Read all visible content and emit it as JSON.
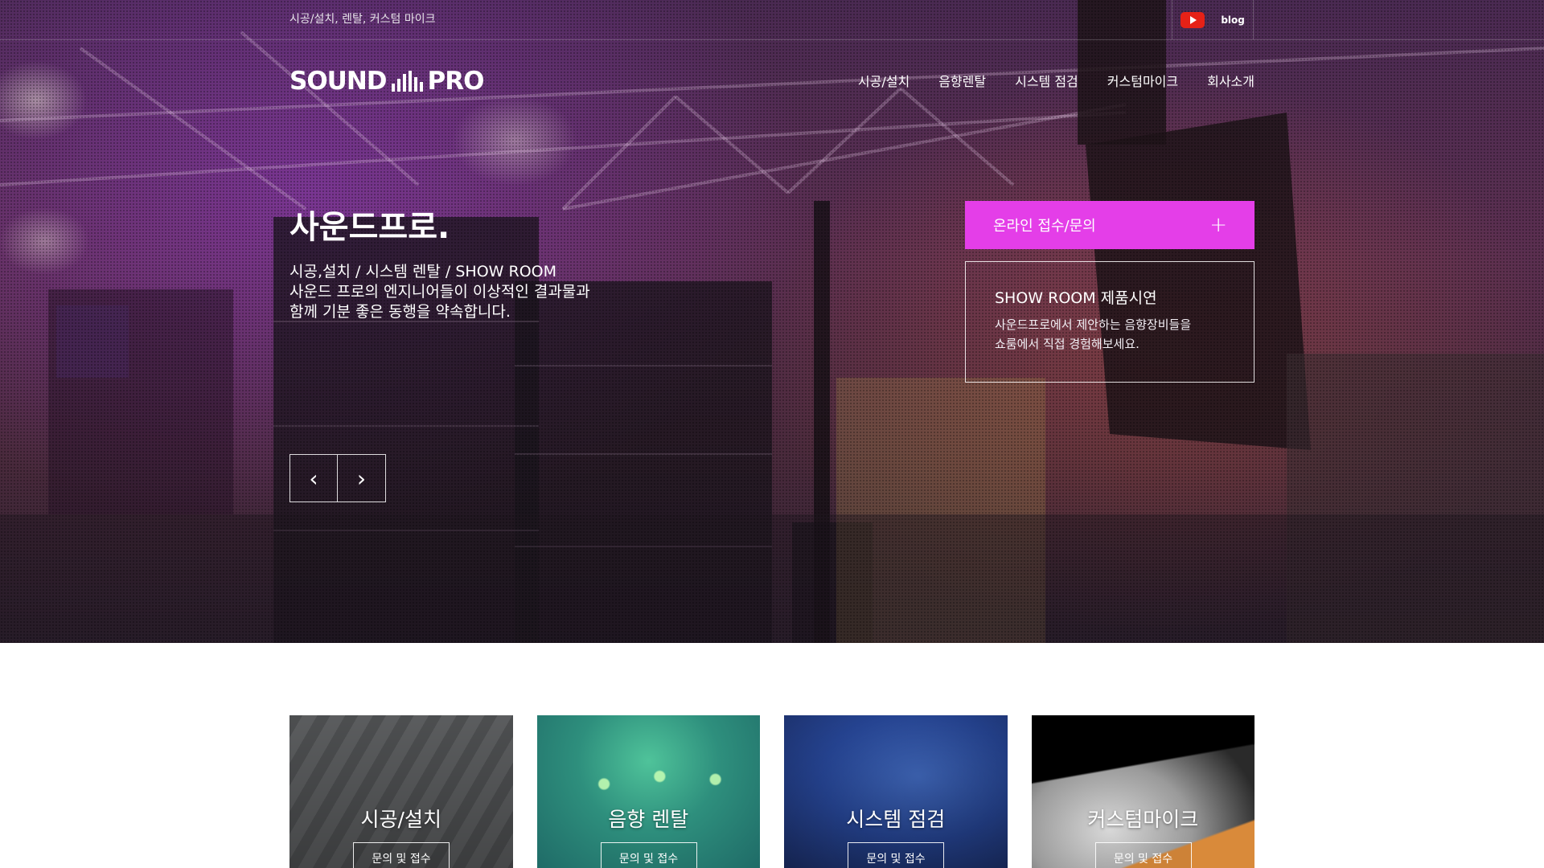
{
  "topbar": {
    "tagline": "시공/설치, 렌탈, 커스텀 마이크",
    "social": [
      {
        "icon": "youtube-icon",
        "color": "#e62117"
      },
      {
        "label": "blog"
      }
    ]
  },
  "header": {
    "logo_text_left": "SOUND",
    "logo_text_right": "PRO",
    "nav": [
      "시공/설치",
      "음향렌탈",
      "시스템 점검",
      "커스텀마이크",
      "회사소개"
    ]
  },
  "hero": {
    "title": "사운드프로.",
    "lines": [
      "시공,설치 / 시스템 렌탈 / SHOW ROOM",
      "사운드 프로의 엔지니어들이 이상적인 결과물과",
      "함께 기분 좋은 동행을 약속합니다."
    ],
    "prev_icon": "chevron-left-icon",
    "next_icon": "chevron-right-icon",
    "prev_glyph": "‹",
    "next_glyph": "›"
  },
  "inquiry": {
    "label": "온라인 접수/문의",
    "plus": "+",
    "color": "#e43ee8"
  },
  "showroom": {
    "title": "SHOW ROOM 제품시연",
    "lines": [
      "사운드프로에서 제안하는 음향장비들을",
      "쇼룸에서 직접 경험해보세요."
    ]
  },
  "cards": [
    {
      "title": "시공/설치",
      "button": "문의 및 접수"
    },
    {
      "title": "음향 렌탈",
      "button": "문의 및 접수"
    },
    {
      "title": "시스템 점검",
      "button": "문의 및 접수"
    },
    {
      "title": "커스텀마이크",
      "button": "문의 및 접수"
    }
  ]
}
